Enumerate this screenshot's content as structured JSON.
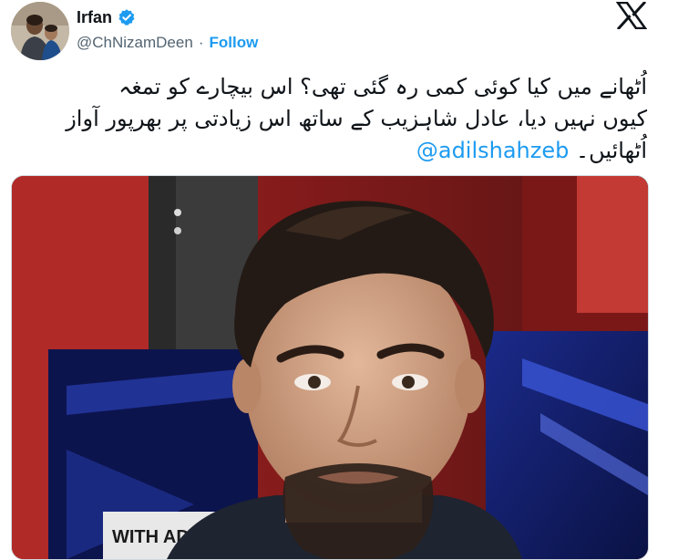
{
  "author": {
    "display_name": "Irfan",
    "handle": "@ChNizamDeen",
    "separator": "·",
    "follow_label": "Follow",
    "verified": true,
    "verified_color": "#1d9bf0"
  },
  "tweet": {
    "text_line1": "اُٹھانے میں کیا کوئی کمی رہ گئی تھی؟ اس بیچارے کو تمغہ",
    "text_line2": "کیوں نہیں دیا، عادل شاہزیب کے ساتھ اس زیادتی پر بھرپور آواز",
    "text_line3": "اُٹھائیں۔",
    "mention": "@adilshahzeb"
  },
  "media": {
    "studio_sign_text": "WITH ADIL"
  },
  "icons": {
    "platform_logo": "x-logo-icon",
    "verified": "verified-badge-icon"
  },
  "colors": {
    "link": "#1d9bf0",
    "secondary_text": "#536471",
    "primary_text": "#0f1419"
  }
}
